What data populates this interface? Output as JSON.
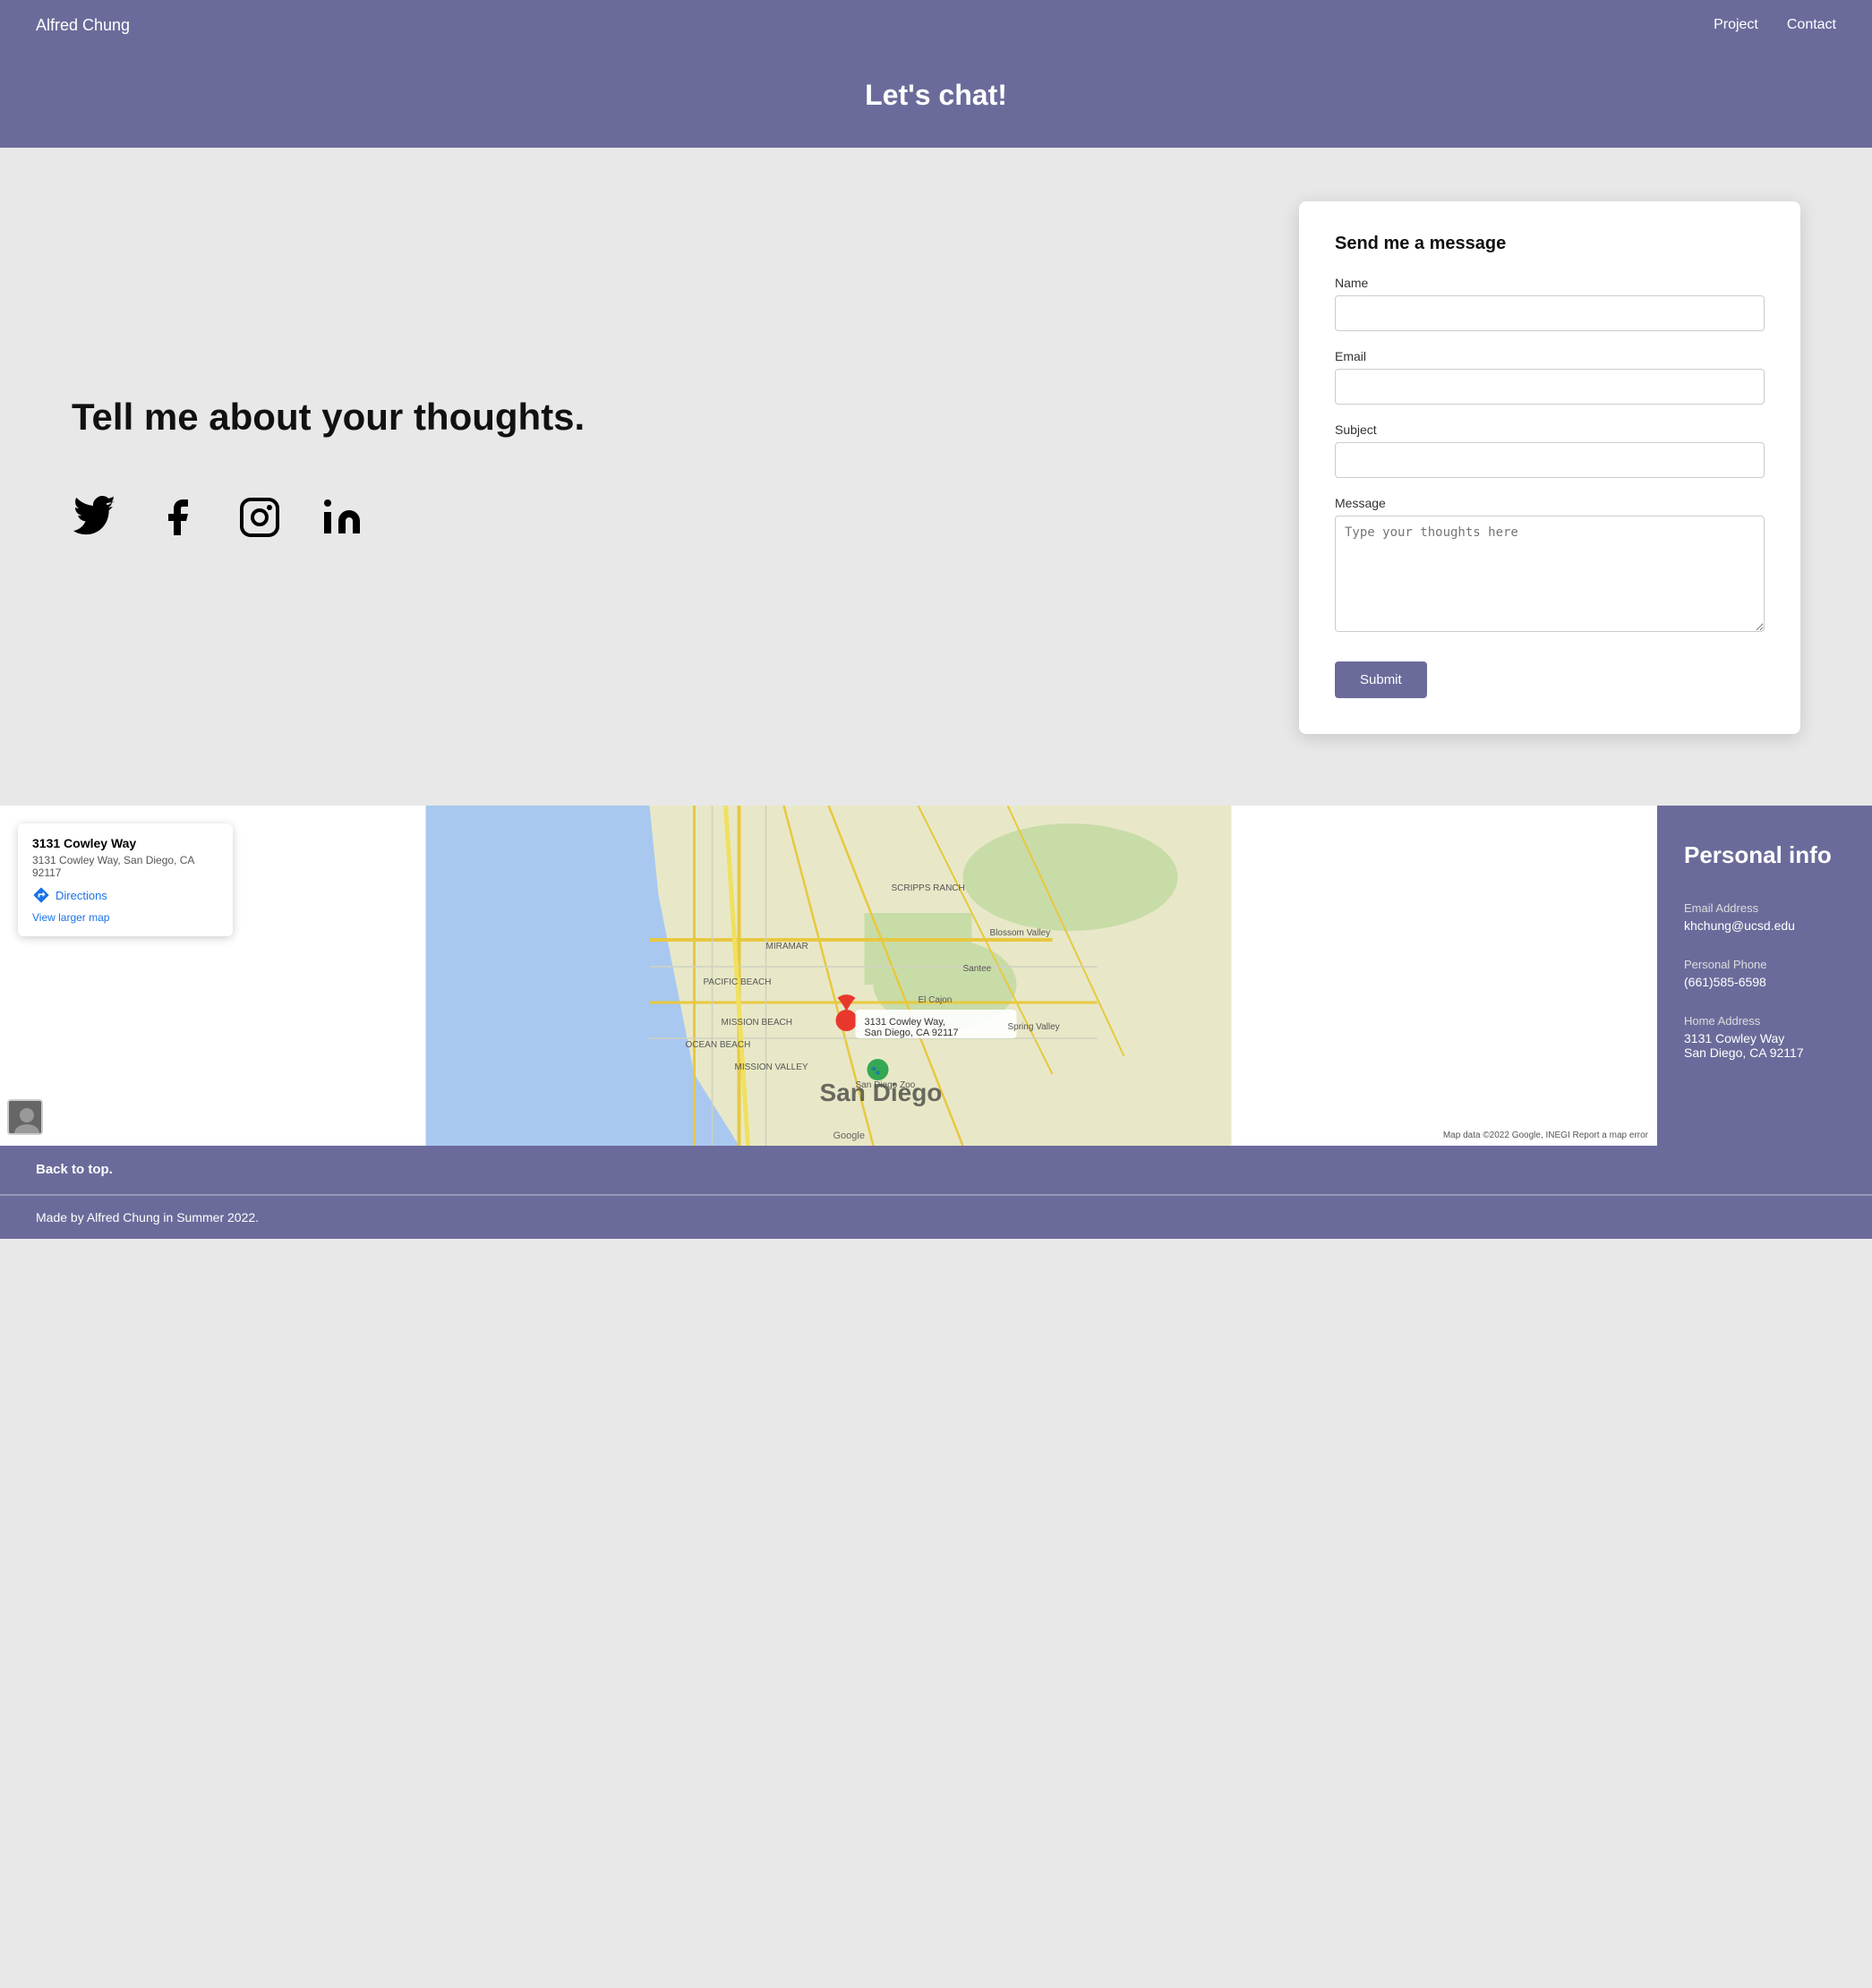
{
  "nav": {
    "brand": "Alfred Chung",
    "links": [
      "Project",
      "Contact"
    ]
  },
  "hero": {
    "title": "Let's chat!"
  },
  "left": {
    "tagline": "Tell me about your thoughts.",
    "social": [
      {
        "name": "twitter",
        "label": "Twitter"
      },
      {
        "name": "facebook",
        "label": "Facebook"
      },
      {
        "name": "instagram",
        "label": "Instagram"
      },
      {
        "name": "linkedin",
        "label": "LinkedIn"
      }
    ]
  },
  "form": {
    "title": "Send me a message",
    "name_label": "Name",
    "name_placeholder": "",
    "email_label": "Email",
    "email_placeholder": "",
    "subject_label": "Subject",
    "subject_placeholder": "",
    "message_label": "Message",
    "message_placeholder": "Type your thoughts here",
    "submit_label": "Submit"
  },
  "map": {
    "address_title": "3131 Cowley Way",
    "address_sub": "3131 Cowley Way, San Diego, CA 92117",
    "directions_label": "Directions",
    "view_larger": "View larger map",
    "pin_label": "3131 Cowley Way, San Diego, CA 92117",
    "attribution": "Map data ©2022 Google, INEGI  Report a map error"
  },
  "personal_info": {
    "title": "Personal info",
    "items": [
      {
        "label": "Email Address",
        "value": "khchung@ucsd.edu"
      },
      {
        "label": "Personal Phone",
        "value": "(661)585-6598"
      },
      {
        "label": "Home Address",
        "value": "3131 Cowley Way\nSan Diego, CA 92117"
      }
    ]
  },
  "footer": {
    "back_to_top": "Back to top.",
    "credit": "Made by Alfred Chung in Summer 2022."
  }
}
